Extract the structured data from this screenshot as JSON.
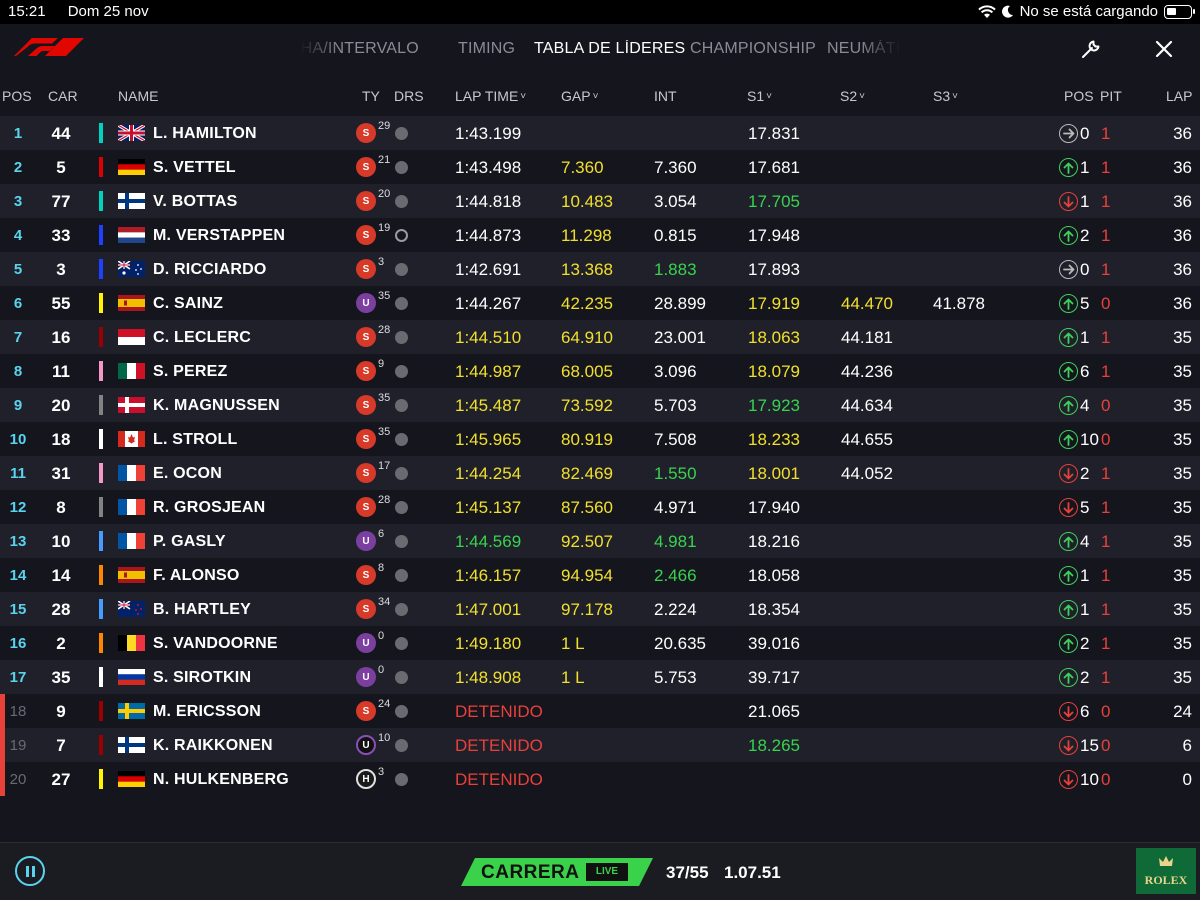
{
  "statusbar": {
    "time": "15:21",
    "date": "Dom 25 nov",
    "battery_text": "No se está cargando"
  },
  "tabs": [
    {
      "label": "FECHA/INTERVALO",
      "active": false
    },
    {
      "label": "TIMING",
      "active": false
    },
    {
      "label": "TABLA DE LÍDERES",
      "active": true
    },
    {
      "label": "CHAMPIONSHIP",
      "active": false
    },
    {
      "label": "NEUMÁTICOS",
      "active": false
    }
  ],
  "columns": {
    "pos": "POS",
    "car": "CAR",
    "name": "NAME",
    "ty": "TY",
    "drs": "DRS",
    "laptime": "LAP TIME",
    "gap": "GAP",
    "int": "INT",
    "s1": "S1",
    "s2": "S2",
    "s3": "S3",
    "pos2": "POS",
    "pit": "PIT",
    "lap": "LAP"
  },
  "colors": {
    "background": "#15151e",
    "row_alt": "#20202b",
    "accent_cyan": "#5ad4ee",
    "personal_best": "#37d44e",
    "improved": "#f1e02a",
    "stopped_red": "#e8413a",
    "race_badge": "#3ad24a"
  },
  "drivers": [
    {
      "pos": "1",
      "car": "44",
      "name": "L. HAMILTON",
      "team_color": "#00d2be",
      "flag": "gb",
      "tyre": "S",
      "tyre_laps": "29",
      "drs": "dot",
      "lap_time": "1:43.199",
      "lap_time_color": "w",
      "gap": "",
      "gap_color": "y",
      "int": "",
      "int_color": "w",
      "s1": "17.831",
      "s1_color": "w",
      "s2": "",
      "s3": "",
      "pos_arrow": "same",
      "pos_change": "0",
      "pit": "1",
      "pit_color": "r",
      "lap": "36",
      "out": false
    },
    {
      "pos": "2",
      "car": "5",
      "name": "S. VETTEL",
      "team_color": "#dc0000",
      "flag": "de",
      "tyre": "S",
      "tyre_laps": "21",
      "drs": "dot",
      "lap_time": "1:43.498",
      "lap_time_color": "w",
      "gap": "7.360",
      "gap_color": "y",
      "int": "7.360",
      "int_color": "w",
      "s1": "17.681",
      "s1_color": "w",
      "s2": "",
      "s3": "",
      "pos_arrow": "up",
      "pos_change": "1",
      "pit": "1",
      "pit_color": "r",
      "lap": "36",
      "out": false
    },
    {
      "pos": "3",
      "car": "77",
      "name": "V. BOTTAS",
      "team_color": "#00d2be",
      "flag": "fi",
      "tyre": "S",
      "tyre_laps": "20",
      "drs": "dot",
      "lap_time": "1:44.818",
      "lap_time_color": "w",
      "gap": "10.483",
      "gap_color": "y",
      "int": "3.054",
      "int_color": "w",
      "s1": "17.705",
      "s1_color": "g",
      "s2": "",
      "s3": "",
      "pos_arrow": "down",
      "pos_change": "1",
      "pit": "1",
      "pit_color": "r",
      "lap": "36",
      "out": false
    },
    {
      "pos": "4",
      "car": "33",
      "name": "M. VERSTAPPEN",
      "team_color": "#1e41ff",
      "flag": "nl",
      "tyre": "S",
      "tyre_laps": "19",
      "drs": "ring",
      "lap_time": "1:44.873",
      "lap_time_color": "w",
      "gap": "11.298",
      "gap_color": "y",
      "int": "0.815",
      "int_color": "w",
      "s1": "17.948",
      "s1_color": "w",
      "s2": "",
      "s3": "",
      "pos_arrow": "up",
      "pos_change": "2",
      "pit": "1",
      "pit_color": "r",
      "lap": "36",
      "out": false
    },
    {
      "pos": "5",
      "car": "3",
      "name": "D. RICCIARDO",
      "team_color": "#1e41ff",
      "flag": "au",
      "tyre": "S",
      "tyre_laps": "3",
      "drs": "dot",
      "lap_time": "1:42.691",
      "lap_time_color": "w",
      "gap": "13.368",
      "gap_color": "y",
      "int": "1.883",
      "int_color": "g",
      "s1": "17.893",
      "s1_color": "w",
      "s2": "",
      "s3": "",
      "pos_arrow": "same",
      "pos_change": "0",
      "pit": "1",
      "pit_color": "r",
      "lap": "36",
      "out": false
    },
    {
      "pos": "6",
      "car": "55",
      "name": "C. SAINZ",
      "team_color": "#fff500",
      "flag": "es",
      "tyre": "U",
      "tyre_laps": "35",
      "drs": "dot",
      "lap_time": "1:44.267",
      "lap_time_color": "w",
      "gap": "42.235",
      "gap_color": "y",
      "int": "28.899",
      "int_color": "w",
      "s1": "17.919",
      "s1_color": "y",
      "s2": "44.470",
      "s2_color": "y",
      "s3": "41.878",
      "s3_color": "w",
      "pos_arrow": "up",
      "pos_change": "5",
      "pit": "0",
      "pit_color": "r",
      "lap": "36",
      "out": false
    },
    {
      "pos": "7",
      "car": "16",
      "name": "C. LECLERC",
      "team_color": "#9b0000",
      "flag": "mc",
      "tyre": "S",
      "tyre_laps": "28",
      "drs": "dot",
      "lap_time": "1:44.510",
      "lap_time_color": "y",
      "gap": "64.910",
      "gap_color": "y",
      "int": "23.001",
      "int_color": "w",
      "s1": "18.063",
      "s1_color": "y",
      "s2": "44.181",
      "s2_color": "w",
      "s3": "",
      "pos_arrow": "up",
      "pos_change": "1",
      "pit": "1",
      "pit_color": "r",
      "lap": "35",
      "out": false
    },
    {
      "pos": "8",
      "car": "11",
      "name": "S. PEREZ",
      "team_color": "#f596c8",
      "flag": "mx",
      "tyre": "S",
      "tyre_laps": "9",
      "drs": "dot",
      "lap_time": "1:44.987",
      "lap_time_color": "y",
      "gap": "68.005",
      "gap_color": "y",
      "int": "3.096",
      "int_color": "w",
      "s1": "18.079",
      "s1_color": "y",
      "s2": "44.236",
      "s2_color": "w",
      "s3": "",
      "pos_arrow": "up",
      "pos_change": "6",
      "pit": "1",
      "pit_color": "r",
      "lap": "35",
      "out": false
    },
    {
      "pos": "9",
      "car": "20",
      "name": "K. MAGNUSSEN",
      "team_color": "#828282",
      "flag": "dk",
      "tyre": "S",
      "tyre_laps": "35",
      "drs": "dot",
      "lap_time": "1:45.487",
      "lap_time_color": "y",
      "gap": "73.592",
      "gap_color": "y",
      "int": "5.703",
      "int_color": "w",
      "s1": "17.923",
      "s1_color": "g",
      "s2": "44.634",
      "s2_color": "w",
      "s3": "",
      "pos_arrow": "up",
      "pos_change": "4",
      "pit": "0",
      "pit_color": "r",
      "lap": "35",
      "out": false
    },
    {
      "pos": "10",
      "car": "18",
      "name": "L. STROLL",
      "team_color": "#ffffff",
      "flag": "ca",
      "tyre": "S",
      "tyre_laps": "35",
      "drs": "dot",
      "lap_time": "1:45.965",
      "lap_time_color": "y",
      "gap": "80.919",
      "gap_color": "y",
      "int": "7.508",
      "int_color": "w",
      "s1": "18.233",
      "s1_color": "y",
      "s2": "44.655",
      "s2_color": "w",
      "s3": "",
      "pos_arrow": "up",
      "pos_change": "10",
      "pit": "0",
      "pit_color": "r",
      "lap": "35",
      "out": false
    },
    {
      "pos": "11",
      "car": "31",
      "name": "E. OCON",
      "team_color": "#f596c8",
      "flag": "fr",
      "tyre": "S",
      "tyre_laps": "17",
      "drs": "dot",
      "lap_time": "1:44.254",
      "lap_time_color": "y",
      "gap": "82.469",
      "gap_color": "y",
      "int": "1.550",
      "int_color": "g",
      "s1": "18.001",
      "s1_color": "y",
      "s2": "44.052",
      "s2_color": "w",
      "s3": "",
      "pos_arrow": "down",
      "pos_change": "2",
      "pit": "1",
      "pit_color": "r",
      "lap": "35",
      "out": false
    },
    {
      "pos": "12",
      "car": "8",
      "name": "R. GROSJEAN",
      "team_color": "#828282",
      "flag": "fr",
      "tyre": "S",
      "tyre_laps": "28",
      "drs": "dot",
      "lap_time": "1:45.137",
      "lap_time_color": "y",
      "gap": "87.560",
      "gap_color": "y",
      "int": "4.971",
      "int_color": "w",
      "s1": "17.940",
      "s1_color": "w",
      "s2": "",
      "s3": "",
      "pos_arrow": "down",
      "pos_change": "5",
      "pit": "1",
      "pit_color": "r",
      "lap": "35",
      "out": false
    },
    {
      "pos": "13",
      "car": "10",
      "name": "P. GASLY",
      "team_color": "#469bff",
      "flag": "fr",
      "tyre": "U",
      "tyre_laps": "6",
      "drs": "dot",
      "lap_time": "1:44.569",
      "lap_time_color": "g",
      "gap": "92.507",
      "gap_color": "y",
      "int": "4.981",
      "int_color": "g",
      "s1": "18.216",
      "s1_color": "w",
      "s2": "",
      "s3": "",
      "pos_arrow": "up",
      "pos_change": "4",
      "pit": "1",
      "pit_color": "r",
      "lap": "35",
      "out": false
    },
    {
      "pos": "14",
      "car": "14",
      "name": "F. ALONSO",
      "team_color": "#ff8700",
      "flag": "es",
      "tyre": "S",
      "tyre_laps": "8",
      "drs": "dot",
      "lap_time": "1:46.157",
      "lap_time_color": "y",
      "gap": "94.954",
      "gap_color": "y",
      "int": "2.466",
      "int_color": "g",
      "s1": "18.058",
      "s1_color": "w",
      "s2": "",
      "s3": "",
      "pos_arrow": "up",
      "pos_change": "1",
      "pit": "1",
      "pit_color": "r",
      "lap": "35",
      "out": false
    },
    {
      "pos": "15",
      "car": "28",
      "name": "B. HARTLEY",
      "team_color": "#469bff",
      "flag": "nz",
      "tyre": "S",
      "tyre_laps": "34",
      "drs": "dot",
      "lap_time": "1:47.001",
      "lap_time_color": "y",
      "gap": "97.178",
      "gap_color": "y",
      "int": "2.224",
      "int_color": "w",
      "s1": "18.354",
      "s1_color": "w",
      "s2": "",
      "s3": "",
      "pos_arrow": "up",
      "pos_change": "1",
      "pit": "1",
      "pit_color": "r",
      "lap": "35",
      "out": false
    },
    {
      "pos": "16",
      "car": "2",
      "name": "S. VANDOORNE",
      "team_color": "#ff8700",
      "flag": "be",
      "tyre": "U",
      "tyre_laps": "0",
      "drs": "dot",
      "lap_time": "1:49.180",
      "lap_time_color": "y",
      "gap": "1 L",
      "gap_color": "y",
      "int": "20.635",
      "int_color": "w",
      "s1": "39.016",
      "s1_color": "w",
      "s2": "",
      "s3": "",
      "pos_arrow": "up",
      "pos_change": "2",
      "pit": "1",
      "pit_color": "r",
      "lap": "35",
      "out": false
    },
    {
      "pos": "17",
      "car": "35",
      "name": "S. SIROTKIN",
      "team_color": "#ffffff",
      "flag": "ru",
      "tyre": "U",
      "tyre_laps": "0",
      "drs": "dot",
      "lap_time": "1:48.908",
      "lap_time_color": "y",
      "gap": "1 L",
      "gap_color": "y",
      "int": "5.753",
      "int_color": "w",
      "s1": "39.717",
      "s1_color": "w",
      "s2": "",
      "s3": "",
      "pos_arrow": "up",
      "pos_change": "2",
      "pit": "1",
      "pit_color": "r",
      "lap": "35",
      "out": false
    },
    {
      "pos": "18",
      "car": "9",
      "name": "M. ERICSSON",
      "team_color": "#9b0000",
      "flag": "se",
      "tyre": "S",
      "tyre_laps": "24",
      "drs": "dot",
      "lap_time": "DETENIDO",
      "lap_time_color": "r",
      "gap": "",
      "gap_color": "y",
      "int": "",
      "int_color": "w",
      "s1": "21.065",
      "s1_color": "w",
      "s2": "",
      "s3": "",
      "pos_arrow": "down",
      "pos_change": "6",
      "pit": "0",
      "pit_color": "r",
      "lap": "24",
      "out": true
    },
    {
      "pos": "19",
      "car": "7",
      "name": "K. RAIKKONEN",
      "team_color": "#9b0000",
      "flag": "fi",
      "tyre": "UH",
      "tyre_laps": "10",
      "drs": "dot",
      "lap_time": "DETENIDO",
      "lap_time_color": "r",
      "gap": "",
      "gap_color": "y",
      "int": "",
      "int_color": "w",
      "s1": "18.265",
      "s1_color": "g",
      "s2": "",
      "s3": "",
      "pos_arrow": "down",
      "pos_change": "15",
      "pit": "0",
      "pit_color": "r",
      "lap": "6",
      "out": true
    },
    {
      "pos": "20",
      "car": "27",
      "name": "N. HULKENBERG",
      "team_color": "#fff500",
      "flag": "de",
      "tyre": "HH",
      "tyre_laps": "3",
      "drs": "dot",
      "lap_time": "DETENIDO",
      "lap_time_color": "r",
      "gap": "",
      "gap_color": "y",
      "int": "",
      "int_color": "w",
      "s1": "",
      "s1_color": "w",
      "s2": "",
      "s3": "",
      "pos_arrow": "down",
      "pos_change": "10",
      "pit": "0",
      "pit_color": "r",
      "lap": "0",
      "out": true
    }
  ],
  "tyre_letters": {
    "S": "S",
    "U": "U",
    "UH": "U",
    "HH": "H"
  },
  "bottom": {
    "session": "CARRERA",
    "live": "LIVE",
    "lap_count": "37/55",
    "race_time": "1.07.51",
    "sponsor": "ROLEX"
  }
}
